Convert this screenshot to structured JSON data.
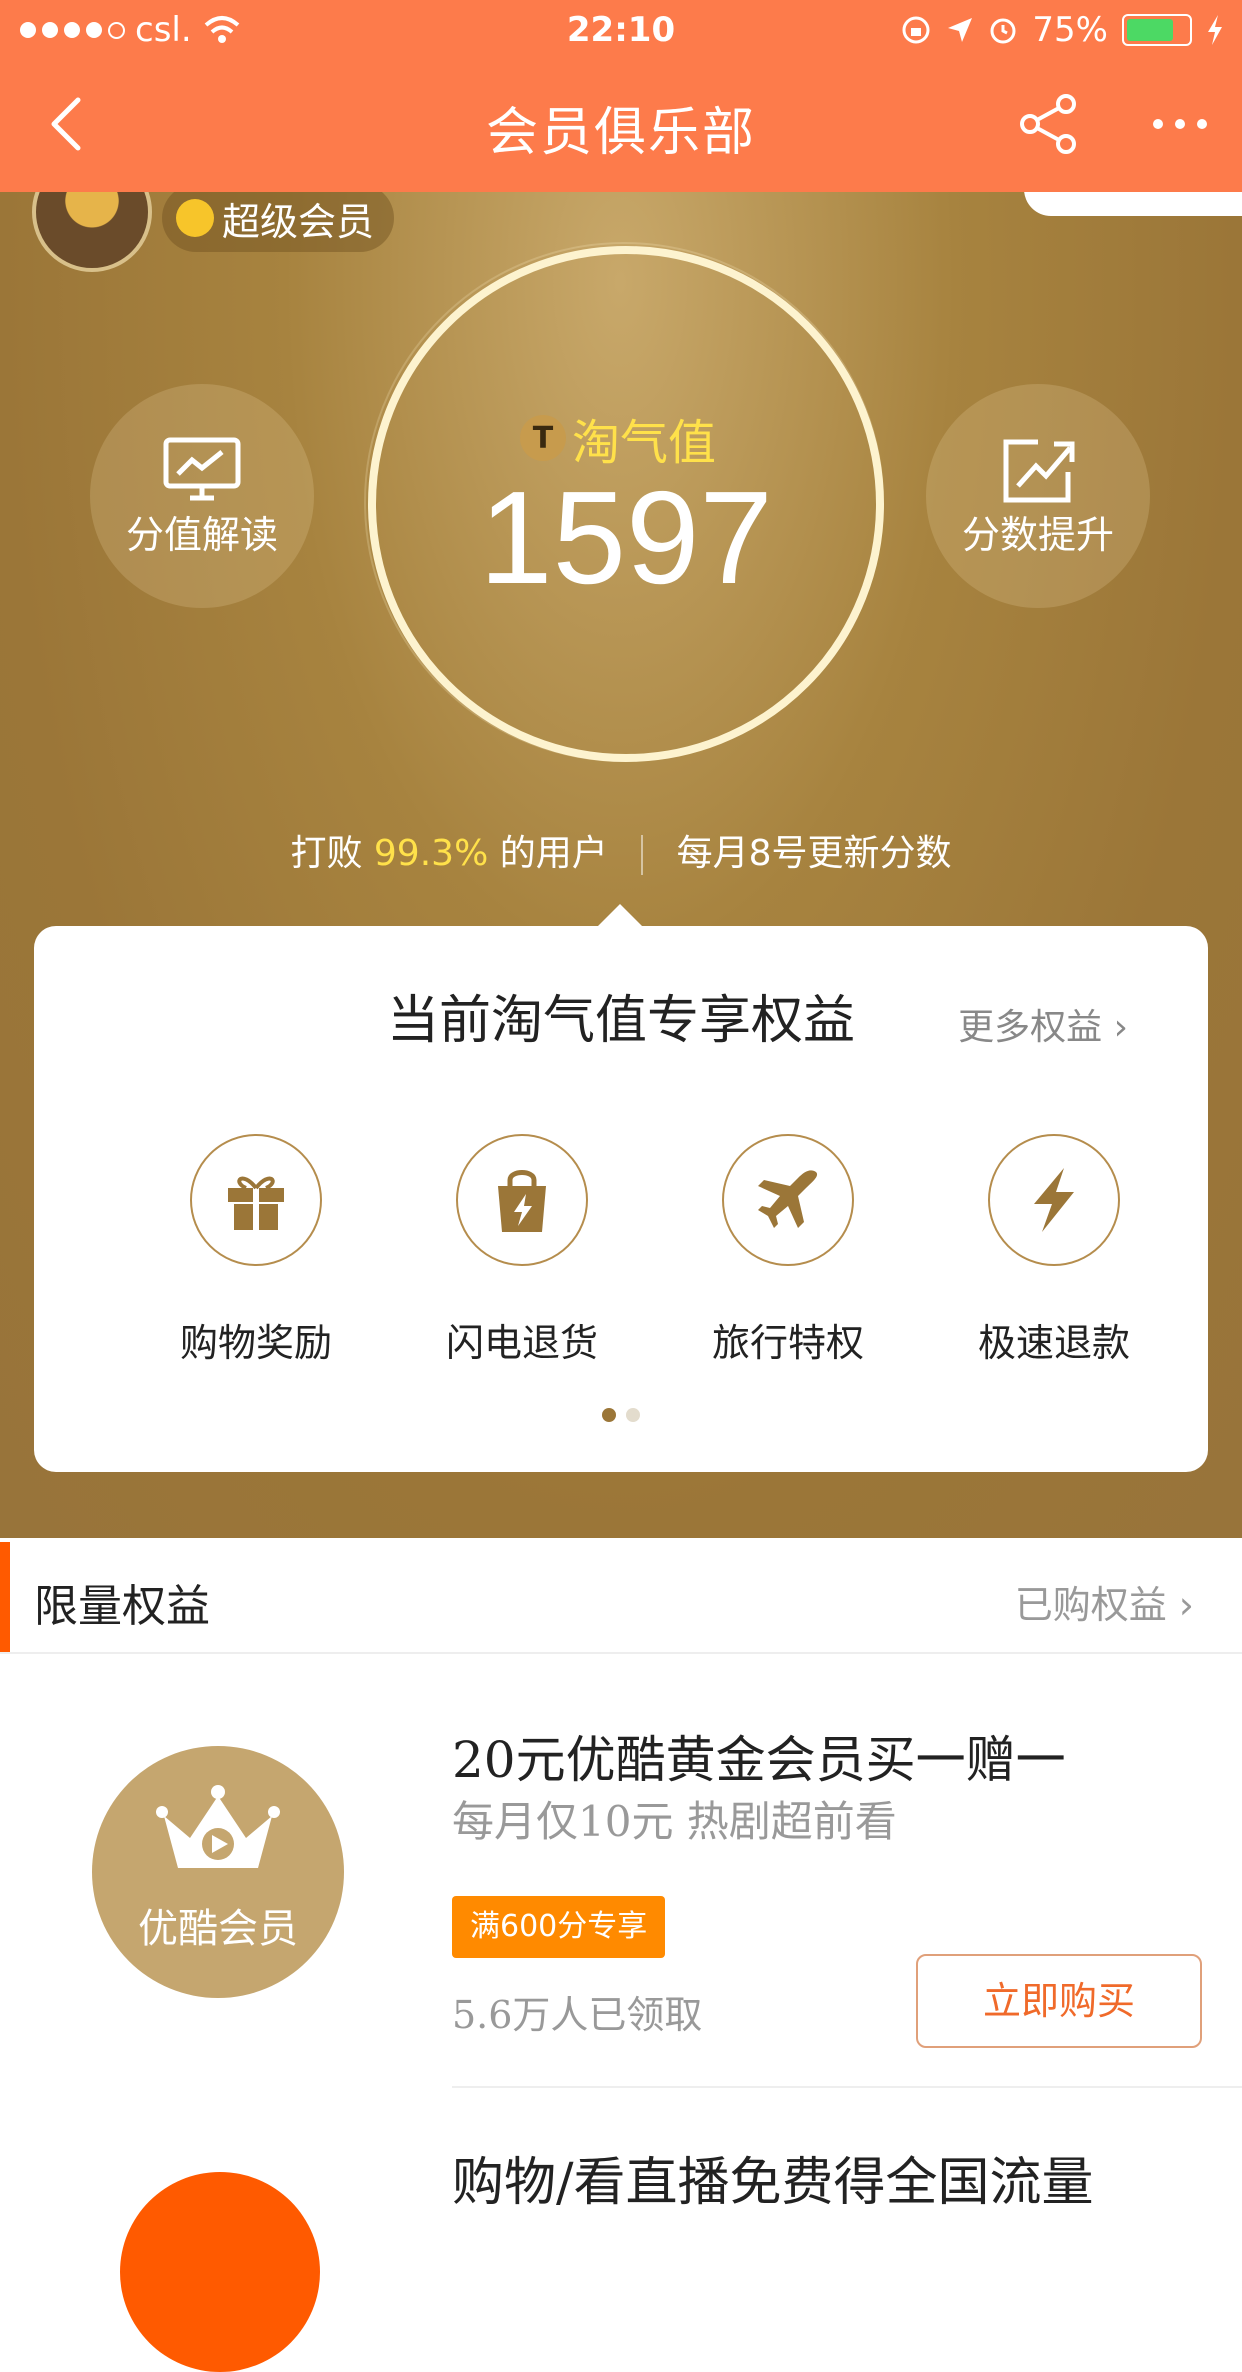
{
  "status_bar": {
    "carrier": "csl.",
    "time": "22:10",
    "battery": "75%",
    "battery_color": "#4cd964"
  },
  "nav": {
    "title": "会员俱乐部",
    "back_icon": "chevron-left-icon",
    "share_icon": "share-icon",
    "more_icon": "more-icon"
  },
  "colors": {
    "header": "#fd7b4b",
    "gold": "#9b7638",
    "highlight": "#ffe14a",
    "accent": "#ff5a00"
  },
  "profile": {
    "vip_label": "超级会员"
  },
  "score": {
    "label": "淘气值",
    "badge": "T",
    "value": "1597"
  },
  "side_buttons": {
    "left_label": "分值解读",
    "right_label": "分数提升"
  },
  "rank": {
    "prefix": "打败",
    "percent": "99.3%",
    "suffix": "的用户",
    "update": "每月8号更新分数"
  },
  "benefits_card": {
    "title": "当前淘气值专享权益",
    "more": "更多权益",
    "items": [
      {
        "label": "购物奖励",
        "icon": "gift-icon"
      },
      {
        "label": "闪电退货",
        "icon": "bag-lightning-icon"
      },
      {
        "label": "旅行特权",
        "icon": "airplane-icon"
      },
      {
        "label": "极速退款",
        "icon": "lightning-icon"
      }
    ],
    "pages": 2,
    "current_page": 1
  },
  "limited": {
    "title": "限量权益",
    "purchased": "已购权益",
    "items": [
      {
        "logo_text": "优酷会员",
        "name": "20元优酷黄金会员买一赠一",
        "sub": "每月仅10元 热剧超前看",
        "tag": "满600分专享",
        "count": "5.6万人已领取",
        "button": "立即购买"
      },
      {
        "name": "购物/看直播免费得全国流量"
      }
    ]
  }
}
